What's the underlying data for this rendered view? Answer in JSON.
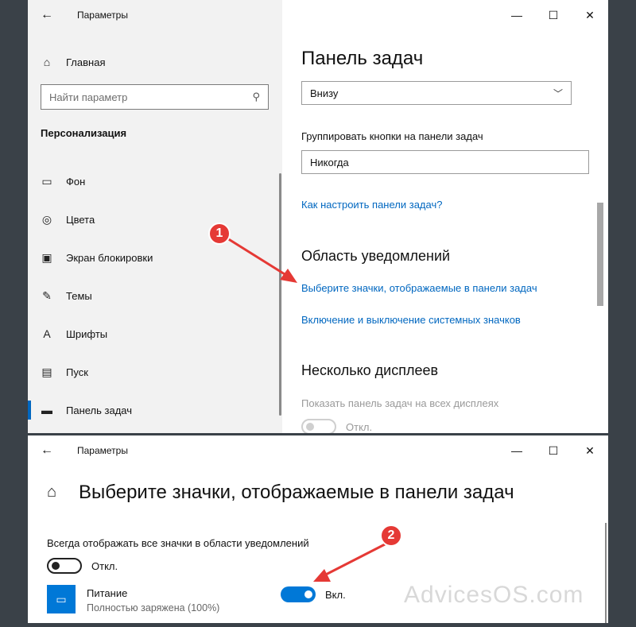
{
  "window1": {
    "title": "Параметры",
    "controls": {
      "minimize": "—",
      "maximize": "☐",
      "close": "✕"
    },
    "sidebar": {
      "home_label": "Главная",
      "search_placeholder": "Найти параметр",
      "section": "Персонализация",
      "items": [
        {
          "label": "Фон",
          "icon": "image-icon",
          "glyph": "▭"
        },
        {
          "label": "Цвета",
          "icon": "palette-icon",
          "glyph": "◎"
        },
        {
          "label": "Экран блокировки",
          "icon": "lock-screen-icon",
          "glyph": "▣"
        },
        {
          "label": "Темы",
          "icon": "themes-icon",
          "glyph": "✎"
        },
        {
          "label": "Шрифты",
          "icon": "fonts-icon",
          "glyph": "A"
        },
        {
          "label": "Пуск",
          "icon": "start-icon",
          "glyph": "▤"
        },
        {
          "label": "Панель задач",
          "icon": "taskbar-icon",
          "glyph": "▬",
          "active": true
        }
      ]
    },
    "main": {
      "title": "Панель задач",
      "position_value": "Внизу",
      "group_label": "Группировать кнопки на панели задач",
      "group_value": "Никогда",
      "link_howto": "Как настроить панели задач?",
      "notif_heading": "Область уведомлений",
      "link_select_icons": "Выберите значки, отображаемые в панели задач",
      "link_system_icons": "Включение и выключение системных значков",
      "displays_heading": "Несколько дисплеев",
      "displays_label": "Показать панель задач на всех дисплеях",
      "displays_toggle_state": "Откл."
    }
  },
  "window2": {
    "title": "Параметры",
    "controls": {
      "minimize": "—",
      "maximize": "☐",
      "close": "✕"
    },
    "page_title": "Выберите значки, отображаемые в панели задач",
    "always_show_label": "Всегда отображать все значки в области уведомлений",
    "always_show_state": "Откл.",
    "app": {
      "name": "Питание",
      "subtitle": "Полностью заряжена (100%)",
      "state": "Вкл."
    }
  },
  "annotations": {
    "badge1": "1",
    "badge2": "2",
    "watermark": "AdvicesOS.com"
  },
  "colors": {
    "accent": "#0078d7",
    "link": "#0067c0",
    "annotation": "#e53935",
    "sidebar_bg": "#f2f2f2"
  }
}
